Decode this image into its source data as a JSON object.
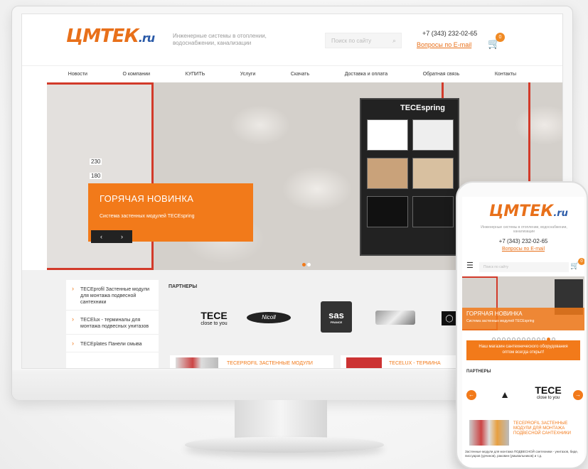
{
  "desktop": {
    "logo": {
      "main": "ЦМТЕК",
      "domain": ".ru"
    },
    "tagline": "Инженерные системы в отоплении, водоснабжении, канализации",
    "search_placeholder": "Поиск по сайту",
    "phone": "+7 (343) 232-02-65",
    "email_link": "Вопросы по E-mail",
    "cart_count": "0",
    "nav": [
      "Новости",
      "О компании",
      "КУПИТЬ",
      "Услуги",
      "Скачать",
      "Доставка и оплата",
      "Обратная связь",
      "Контакты"
    ],
    "hero": {
      "title": "ГОРЯЧАЯ НОВИНКА",
      "subtitle": "Система застенных модулей TECEspring",
      "product_brand": "TECEspring",
      "dim_1": "230",
      "dim_2": "180",
      "prev": "‹",
      "next": "›"
    },
    "sidebar": [
      "TECEprofil Застенные модули для монтажа подвесной сантехники",
      "TECElux - терминалы для монтажа подвесных унитазов",
      "TECEplates Панели смыва"
    ],
    "partners_heading": "ПАРТНЕРЫ",
    "partners": {
      "tece": "TECE",
      "tece_sub": "close to you",
      "nicoll": "Nicoll",
      "sas": "sas",
      "sas_sub": "FRANCE"
    },
    "cards": [
      "TECEPROFIL ЗАСТЕННЫЕ МОДУЛИ",
      "TECELUX - ТЕРМИНА"
    ]
  },
  "mobile": {
    "logo": {
      "main": "ЦМТЕК",
      "domain": ".ru"
    },
    "tagline": "Инженерные системы в отоплении, водоснабжении, канализации",
    "phone": "+7 (343) 232-02-65",
    "email_link": "Вопросы по E-mail",
    "search_placeholder": "Поиск по сайту",
    "cart_count": "0",
    "hero_title": "ГОРЯЧАЯ НОВИНКА",
    "hero_subtitle": "Система застенных модулей TECEspring",
    "banner": "Наш магазин сантехнического оборудования оптом всегда открыт!",
    "partners_heading": "ПАРТНЕРЫ",
    "partner_tece": "TECE",
    "partner_tece_sub": "close to you",
    "product_title": "TECEPROFIL ЗАСТЕННЫЕ МОДУЛИ ДЛЯ МОНТАЖА ПОДВЕСНОЙ САНТЕХНИКИ",
    "product_desc": "Застенные модули для монтажа ПОДВЕСНОЙ сантехники - унитазов, биде, писсуаров (урчинов), раковин (умывальников) и т.д."
  },
  "colors": {
    "accent": "#f27a1a",
    "brand_blue": "#2a5aa8",
    "frame_red": "#d23a2a"
  }
}
